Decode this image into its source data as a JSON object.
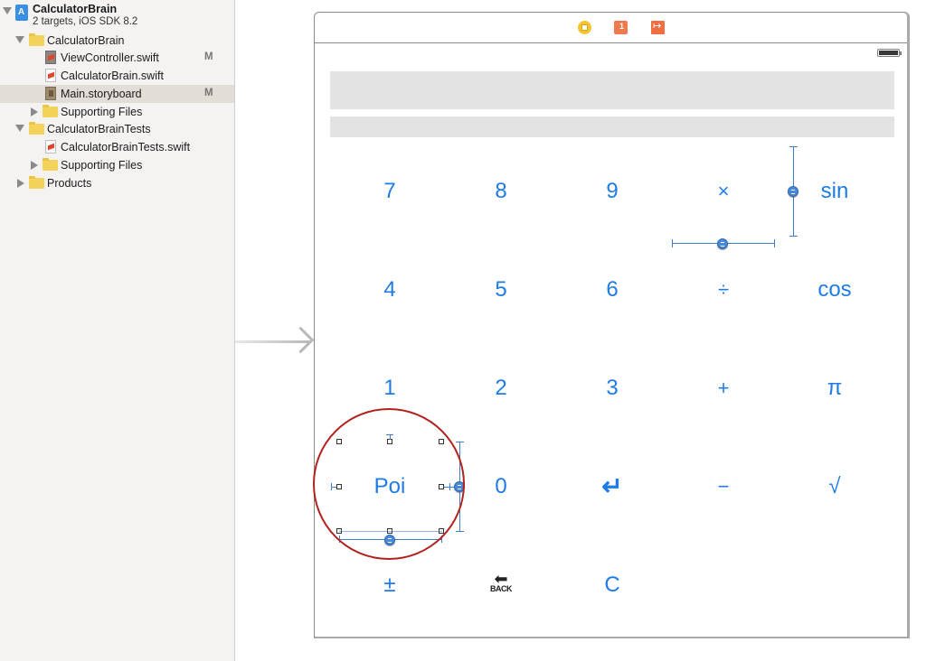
{
  "navigator": {
    "project": {
      "name": "CalculatorBrain",
      "subtitle": "2 targets, iOS SDK 8.2"
    },
    "items": [
      {
        "label": "CalculatorBrain",
        "type": "folder",
        "expanded": true
      },
      {
        "label": "ViewController.swift",
        "type": "swift-file",
        "badge": "M"
      },
      {
        "label": "CalculatorBrain.swift",
        "type": "swift-file",
        "badge": ""
      },
      {
        "label": "Main.storyboard",
        "type": "storyboard-file",
        "badge": "M",
        "selected": true
      },
      {
        "label": "Supporting Files",
        "type": "folder",
        "expanded": false
      },
      {
        "label": "CalculatorBrainTests",
        "type": "folder",
        "expanded": true
      },
      {
        "label": "CalculatorBrainTests.swift",
        "type": "swift-file",
        "badge": ""
      },
      {
        "label": "Supporting Files",
        "type": "folder",
        "expanded": false
      },
      {
        "label": "Products",
        "type": "folder",
        "expanded": false
      }
    ]
  },
  "scene": {
    "bar_icons": [
      "view-controller-icon",
      "first-responder-icon",
      "exit-icon"
    ],
    "keys": [
      [
        "7",
        "8",
        "9",
        "×",
        "sin"
      ],
      [
        "4",
        "5",
        "6",
        "÷",
        "cos"
      ],
      [
        "1",
        "2",
        "3",
        "+",
        "π"
      ],
      [
        "Poi",
        "0",
        "↵",
        "−",
        "√"
      ],
      [
        "±",
        "BACK",
        "C"
      ]
    ],
    "accent_color": "#1f7ce6",
    "annotation_color": "#b3221e"
  }
}
